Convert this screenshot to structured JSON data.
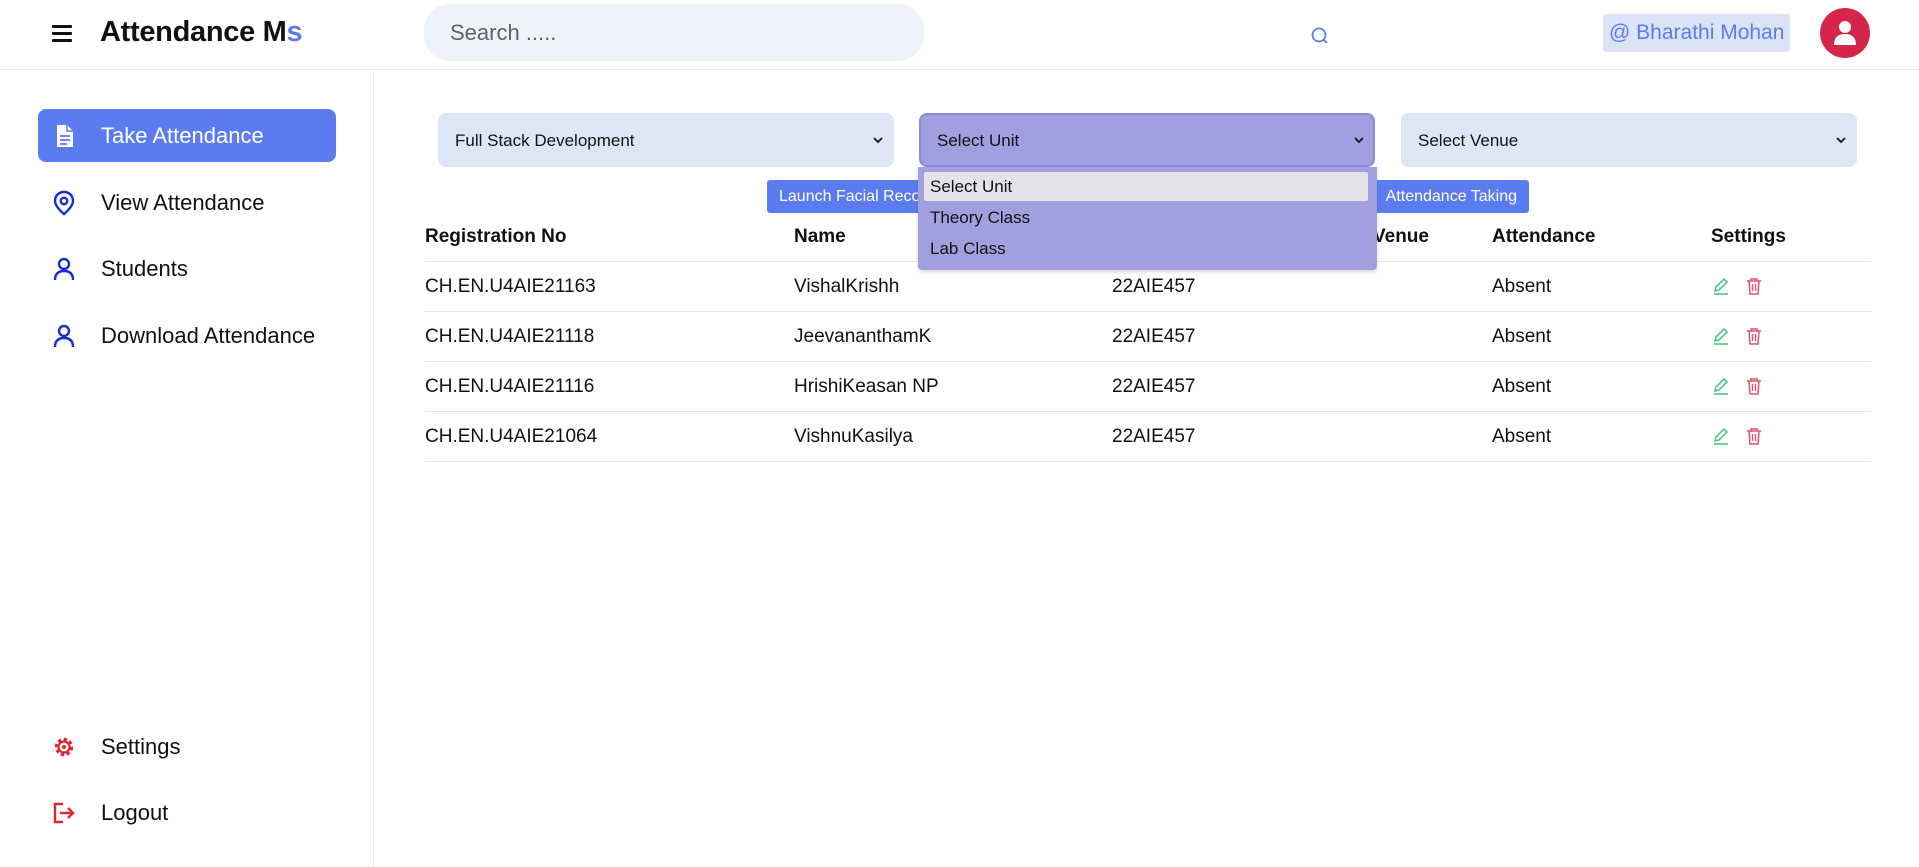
{
  "header": {
    "brand_main": "Attendance M",
    "brand_accent": "s",
    "search_placeholder": "Search .....",
    "user": "@ Bharathi Mohan"
  },
  "sidebar": {
    "items": [
      {
        "label": "Take Attendance",
        "icon": "document-icon"
      },
      {
        "label": "View Attendance",
        "icon": "location-pin-icon"
      },
      {
        "label": "Students",
        "icon": "user-icon"
      },
      {
        "label": "Download Attendance",
        "icon": "user-icon"
      }
    ],
    "bottom": [
      {
        "label": "Settings",
        "icon": "gear-icon"
      },
      {
        "label": "Logout",
        "icon": "logout-icon"
      }
    ]
  },
  "filters": {
    "course": "Full Stack Development",
    "unit": "Select Unit",
    "venue": "Select Venue",
    "unit_options": [
      "Select Unit",
      "Theory Class",
      "Lab Class"
    ]
  },
  "launch_button": {
    "left_text": "Launch Facial Reco",
    "right_text": "Attendance Taking"
  },
  "table": {
    "headers": [
      "Registration No",
      "Name",
      "Venue",
      "Attendance",
      "Settings"
    ],
    "rows": [
      {
        "reg": "CH.EN.U4AIE21163",
        "name": "VishalKrishh",
        "code": "22AIE457",
        "attendance": "Absent"
      },
      {
        "reg": "CH.EN.U4AIE21118",
        "name": "JeevananthamK",
        "code": "22AIE457",
        "attendance": "Absent"
      },
      {
        "reg": "CH.EN.U4AIE21116",
        "name": "HrishiKeasan NP",
        "code": "22AIE457",
        "attendance": "Absent"
      },
      {
        "reg": "CH.EN.U4AIE21064",
        "name": "VishnuKasilya",
        "code": "22AIE457",
        "attendance": "Absent"
      }
    ]
  },
  "colors": {
    "accent": "#5b7cf0",
    "danger": "#d5254a",
    "edit": "#3cc47c",
    "delete": "#e0536b",
    "open_select": "#a19fe0"
  }
}
